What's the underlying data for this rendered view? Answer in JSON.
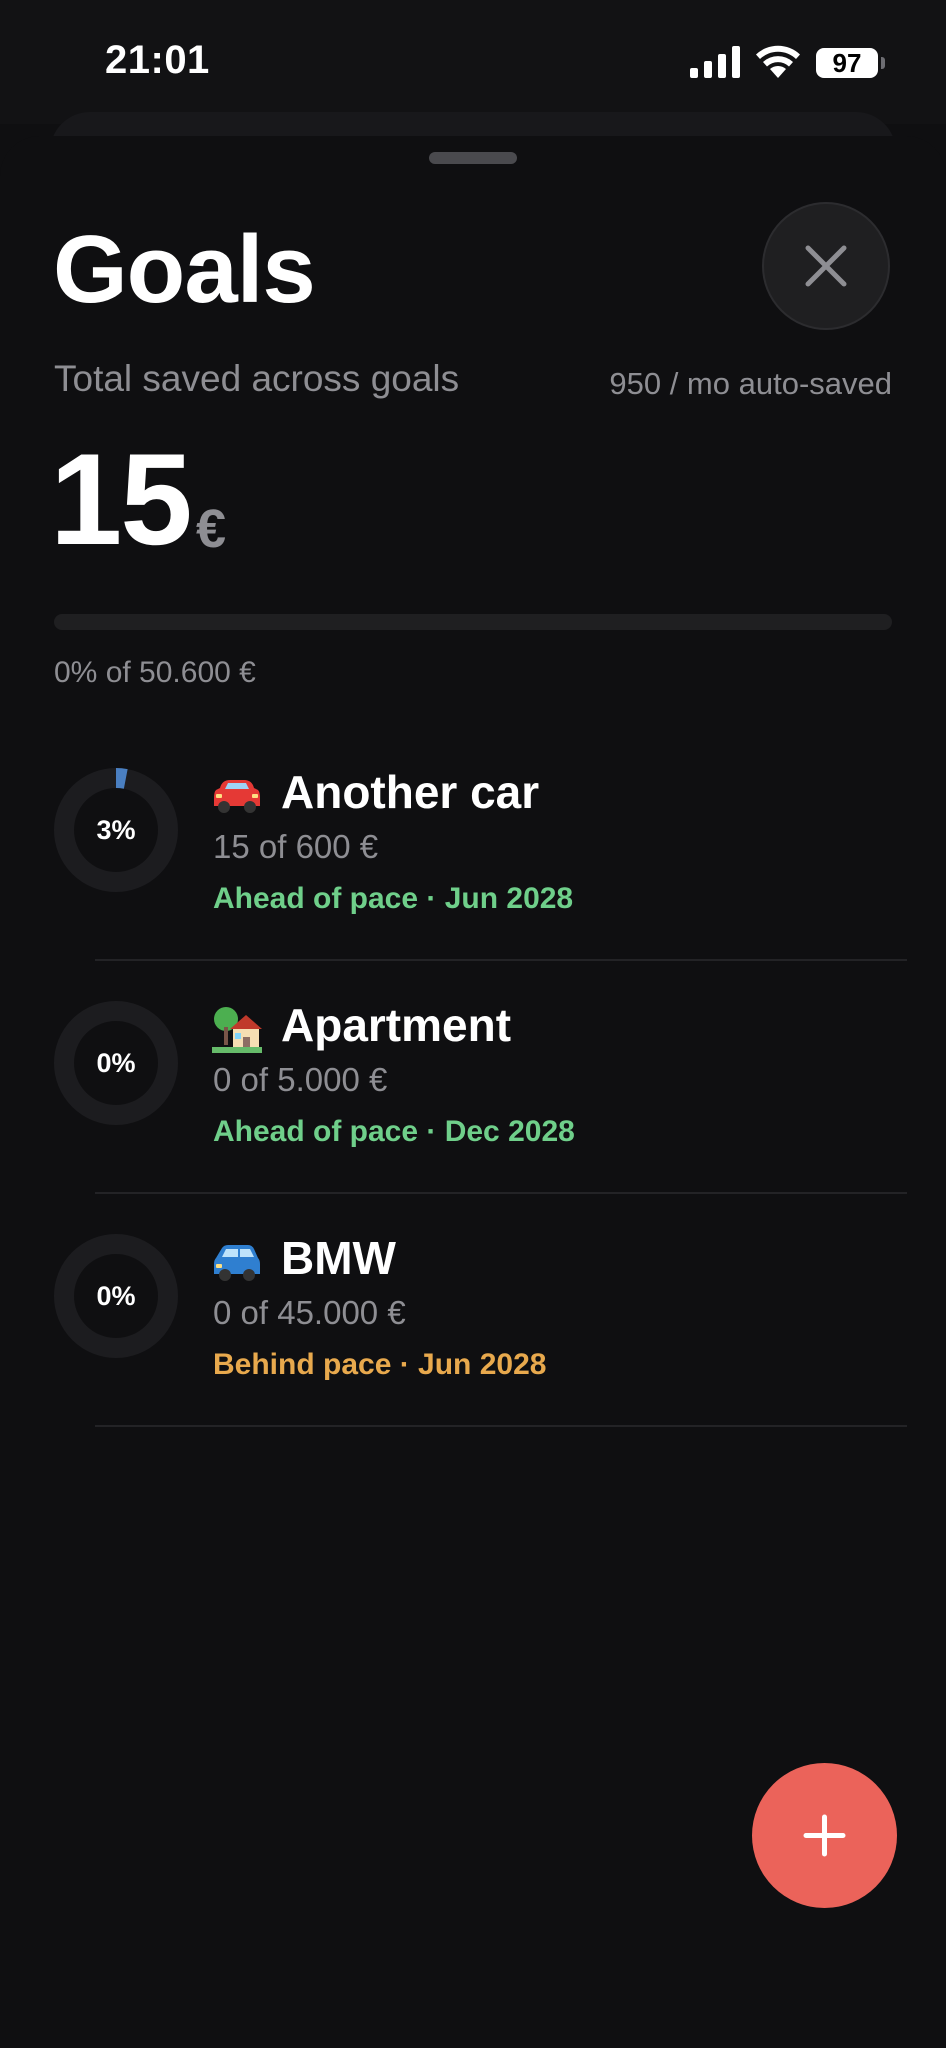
{
  "status_bar": {
    "time": "21:01",
    "battery": "97",
    "icons": [
      "cellular-signal-icon",
      "wifi-icon",
      "battery-icon"
    ]
  },
  "header": {
    "title": "Goals",
    "close_icon": "close-icon"
  },
  "summary": {
    "label": "Total saved across goals",
    "auto_saved": "950 / mo auto-saved",
    "total": "15",
    "currency": "€",
    "progress_percent": 0,
    "progress_text": "0% of 50.600 €"
  },
  "goals": [
    {
      "emoji": "red-car-icon",
      "name": "Another car",
      "amount": "15 of 600 €",
      "percent_label": "3%",
      "percent": 3,
      "status": "Ahead of pace · Jun 2028",
      "status_color": "#6fcf8a"
    },
    {
      "emoji": "house-with-garden-icon",
      "name": "Apartment",
      "amount": "0 of 5.000 €",
      "percent_label": "0%",
      "percent": 0,
      "status": "Ahead of pace · Dec 2028",
      "status_color": "#6fcf8a"
    },
    {
      "emoji": "blue-car-icon",
      "name": "BMW",
      "amount": "0 of 45.000 €",
      "percent_label": "0%",
      "percent": 0,
      "status": "Behind pace · Jun 2028",
      "status_color": "#e8a94d"
    }
  ],
  "fab": {
    "icon": "plus-icon",
    "color": "#eb635a"
  },
  "colors": {
    "background": "#0f0f11",
    "ring_progress": "#4a7fc1",
    "ring_track": "#1c1c1f"
  }
}
